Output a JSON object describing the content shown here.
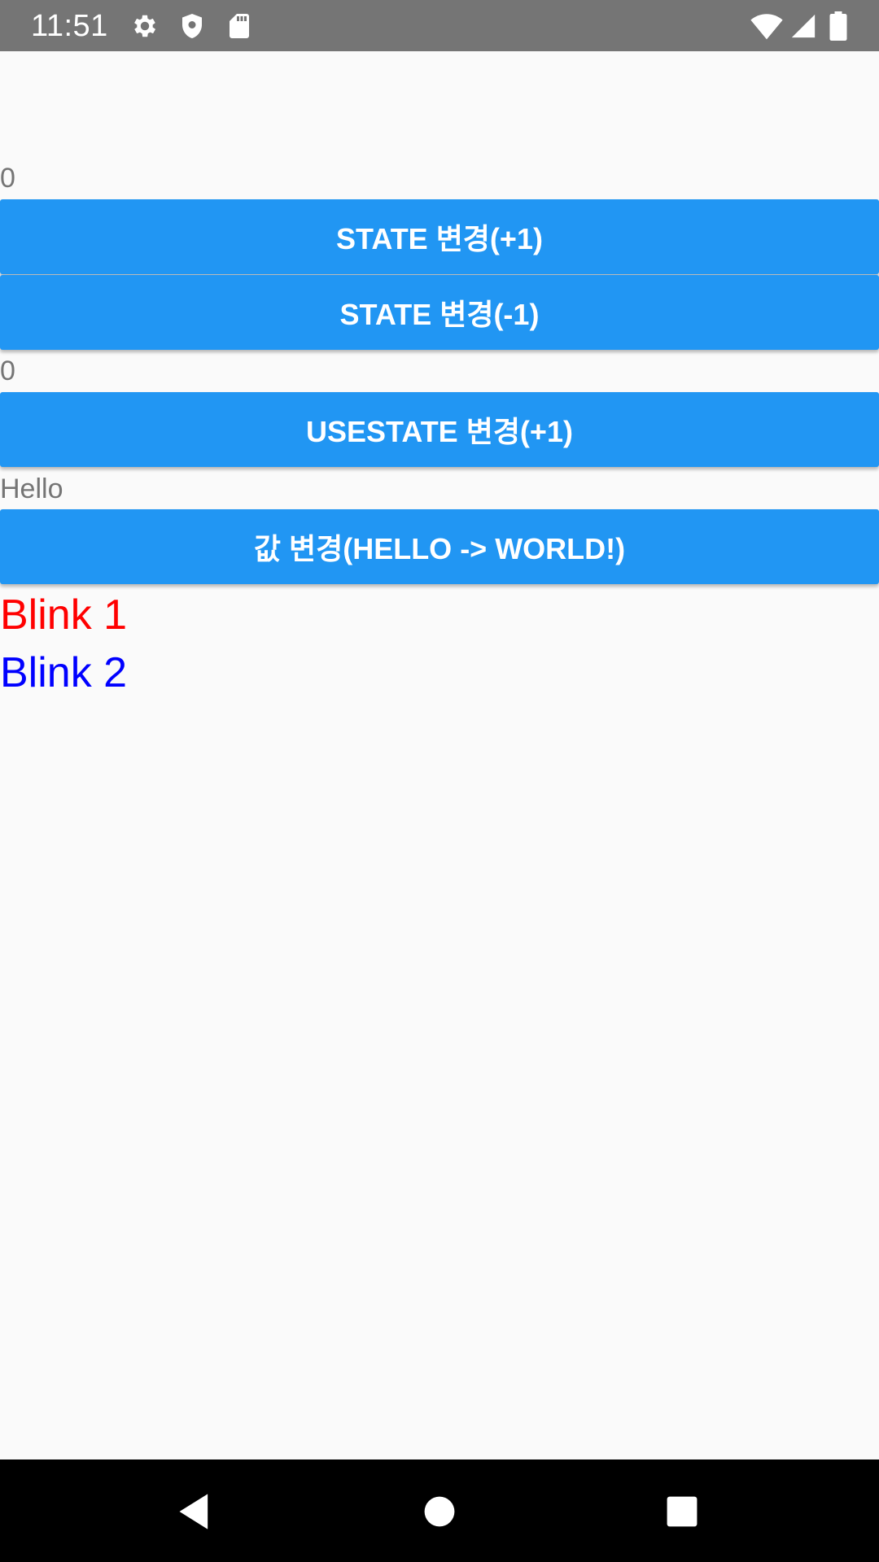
{
  "status_bar": {
    "time": "11:51",
    "icons": [
      "gear-icon",
      "shield-icon",
      "sd-card-icon",
      "wifi-icon",
      "signal-icon",
      "battery-icon"
    ],
    "background": "#757575"
  },
  "main": {
    "state_value": "0",
    "state_increment_button": "STATE 변경(+1)",
    "state_decrement_button": "STATE 변경(-1)",
    "usestate_value": "0",
    "usestate_increment_button": "USESTATE 변경(+1)",
    "greeting_value": "Hello",
    "change_value_button": "값 변경(HELLO -> WORLD!)",
    "blink_1": "Blink 1",
    "blink_2": "Blink 2"
  },
  "colors": {
    "button": "#2196f3",
    "button_text": "#ffffff",
    "muted_text": "#757575",
    "blink_1": "#ff0000",
    "blink_2": "#0000ff",
    "background": "#fafafa"
  },
  "nav_bar": {
    "icons": [
      "back-icon",
      "home-icon",
      "recents-icon"
    ]
  }
}
